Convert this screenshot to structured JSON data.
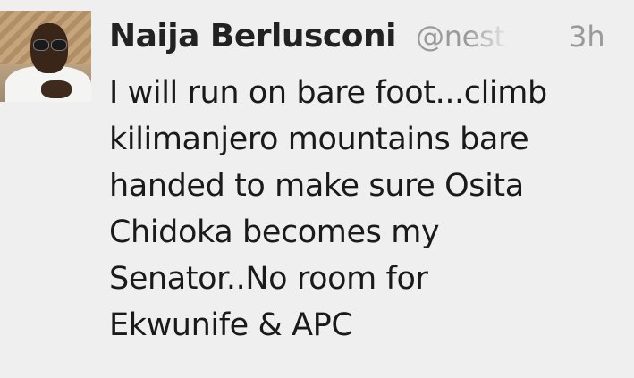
{
  "tweet": {
    "author_name": "Naija Berlusconi",
    "author_handle": "@nest",
    "timestamp": "3h",
    "text_lines": [
      "I will run on bare foot...climb",
      "kilimanjero mountains bare",
      "handed to make sure Osita",
      "Chidoka becomes my",
      "Senator..No room for",
      "Ekwunife & APC"
    ]
  },
  "colors": {
    "background": "#efefef",
    "name": "#222222",
    "meta": "#9a9a9a",
    "text": "#1a1a1a"
  }
}
